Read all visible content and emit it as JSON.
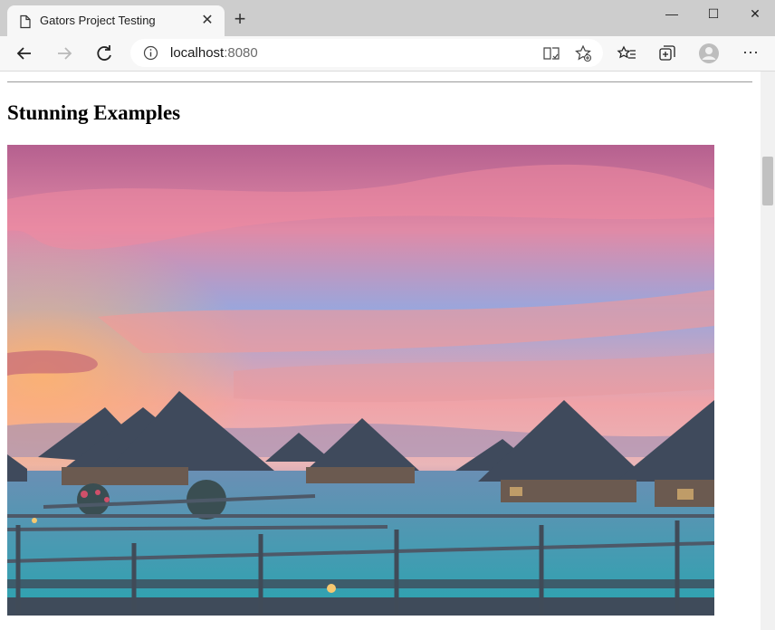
{
  "browser": {
    "tab_title": "Gators Project Testing",
    "address_host": "localhost",
    "address_port": ":8080"
  },
  "page": {
    "heading": "Stunning Examples",
    "image_alt": "Sunset over overwater bungalows"
  },
  "colors": {
    "tabstrip": "#cdcdcd",
    "toolbar": "#f7f7f7",
    "scrollbar_thumb": "#c1c1c1"
  }
}
